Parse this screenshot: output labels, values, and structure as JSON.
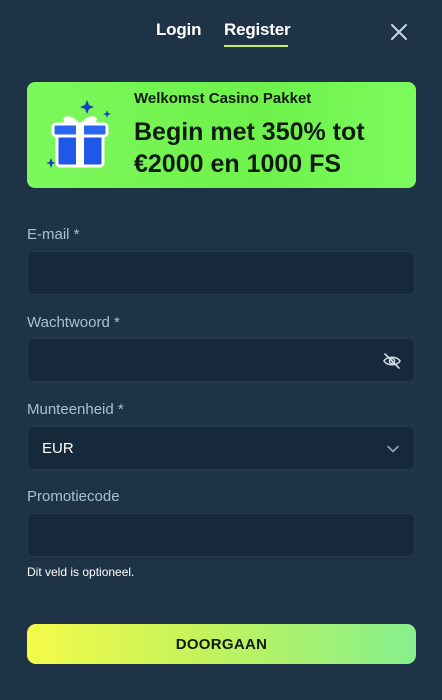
{
  "tabs": {
    "login": "Login",
    "register": "Register",
    "active": "register"
  },
  "banner": {
    "subtitle": "Welkomst Casino Pakket",
    "headline": "Begin met 350% tot €2000 en 1000 FS",
    "icon": "gift-icon",
    "color": "#74f552"
  },
  "form": {
    "email_label": "E-mail *",
    "email_value": "",
    "password_label": "Wachtwoord *",
    "password_value": "",
    "currency_label": "Munteenheid *",
    "currency_value": "EUR",
    "promo_label": "Promotiecode",
    "promo_value": "",
    "promo_hint": "Dit veld is optioneel."
  },
  "submit_label": "DOORGAAN",
  "colors": {
    "background": "#1e3446",
    "field_bg": "#16293a",
    "accent": "#c6f24a"
  }
}
